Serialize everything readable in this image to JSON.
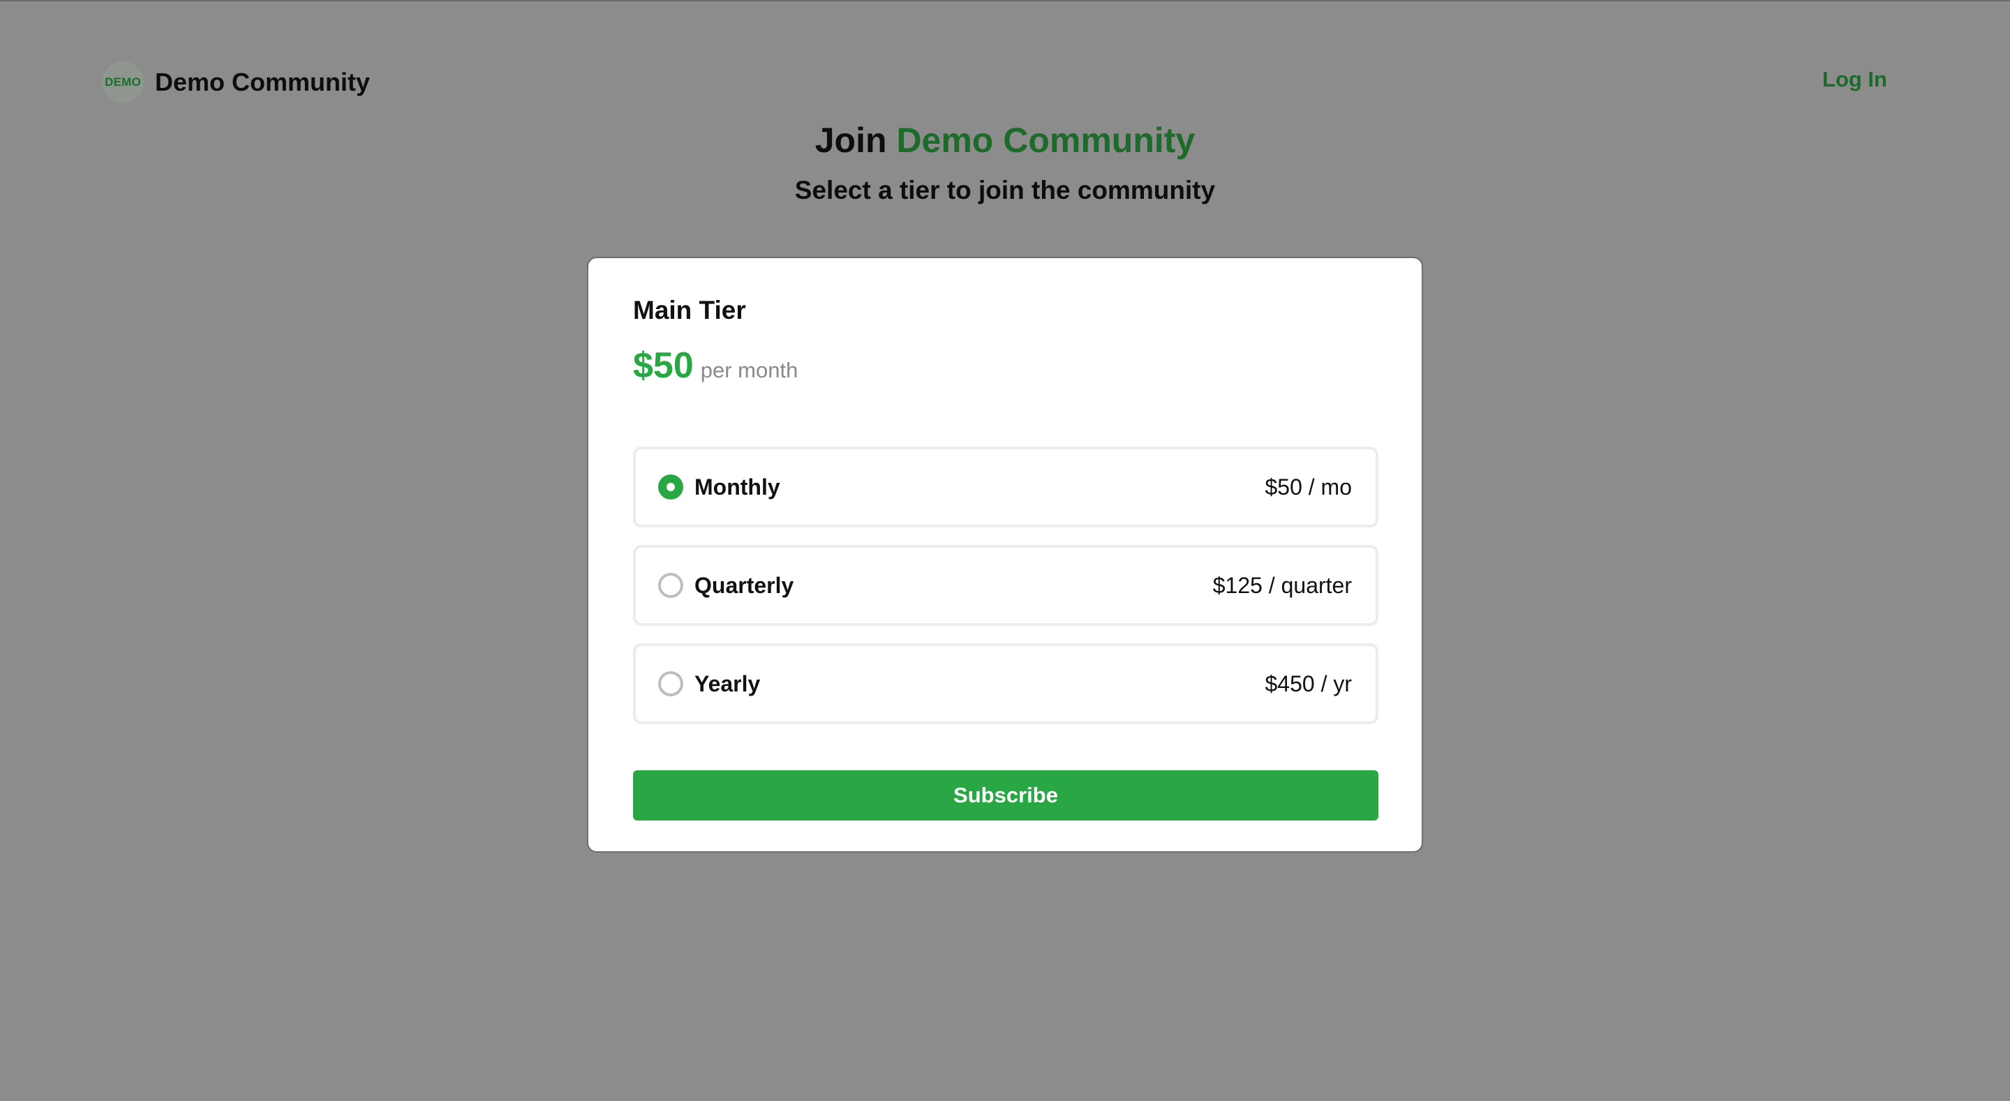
{
  "header": {
    "logo_text": "DEMO",
    "brand_name": "Demo Community",
    "login_label": "Log In"
  },
  "hero": {
    "title_prefix": "Join",
    "title_accent": "Demo Community",
    "subtitle": "Select a tier to join the community"
  },
  "tier": {
    "name": "Main Tier",
    "price": "$50",
    "price_period": "per month",
    "options": [
      {
        "label": "Monthly",
        "price": "$50 / mo",
        "selected": true
      },
      {
        "label": "Quarterly",
        "price": "$125 / quarter",
        "selected": false
      },
      {
        "label": "Yearly",
        "price": "$450 / yr",
        "selected": false
      }
    ],
    "subscribe_label": "Subscribe"
  },
  "colors": {
    "accent": "#29a745",
    "accent_dark": "#1c6b2b",
    "backdrop": "#8c8c8c"
  }
}
